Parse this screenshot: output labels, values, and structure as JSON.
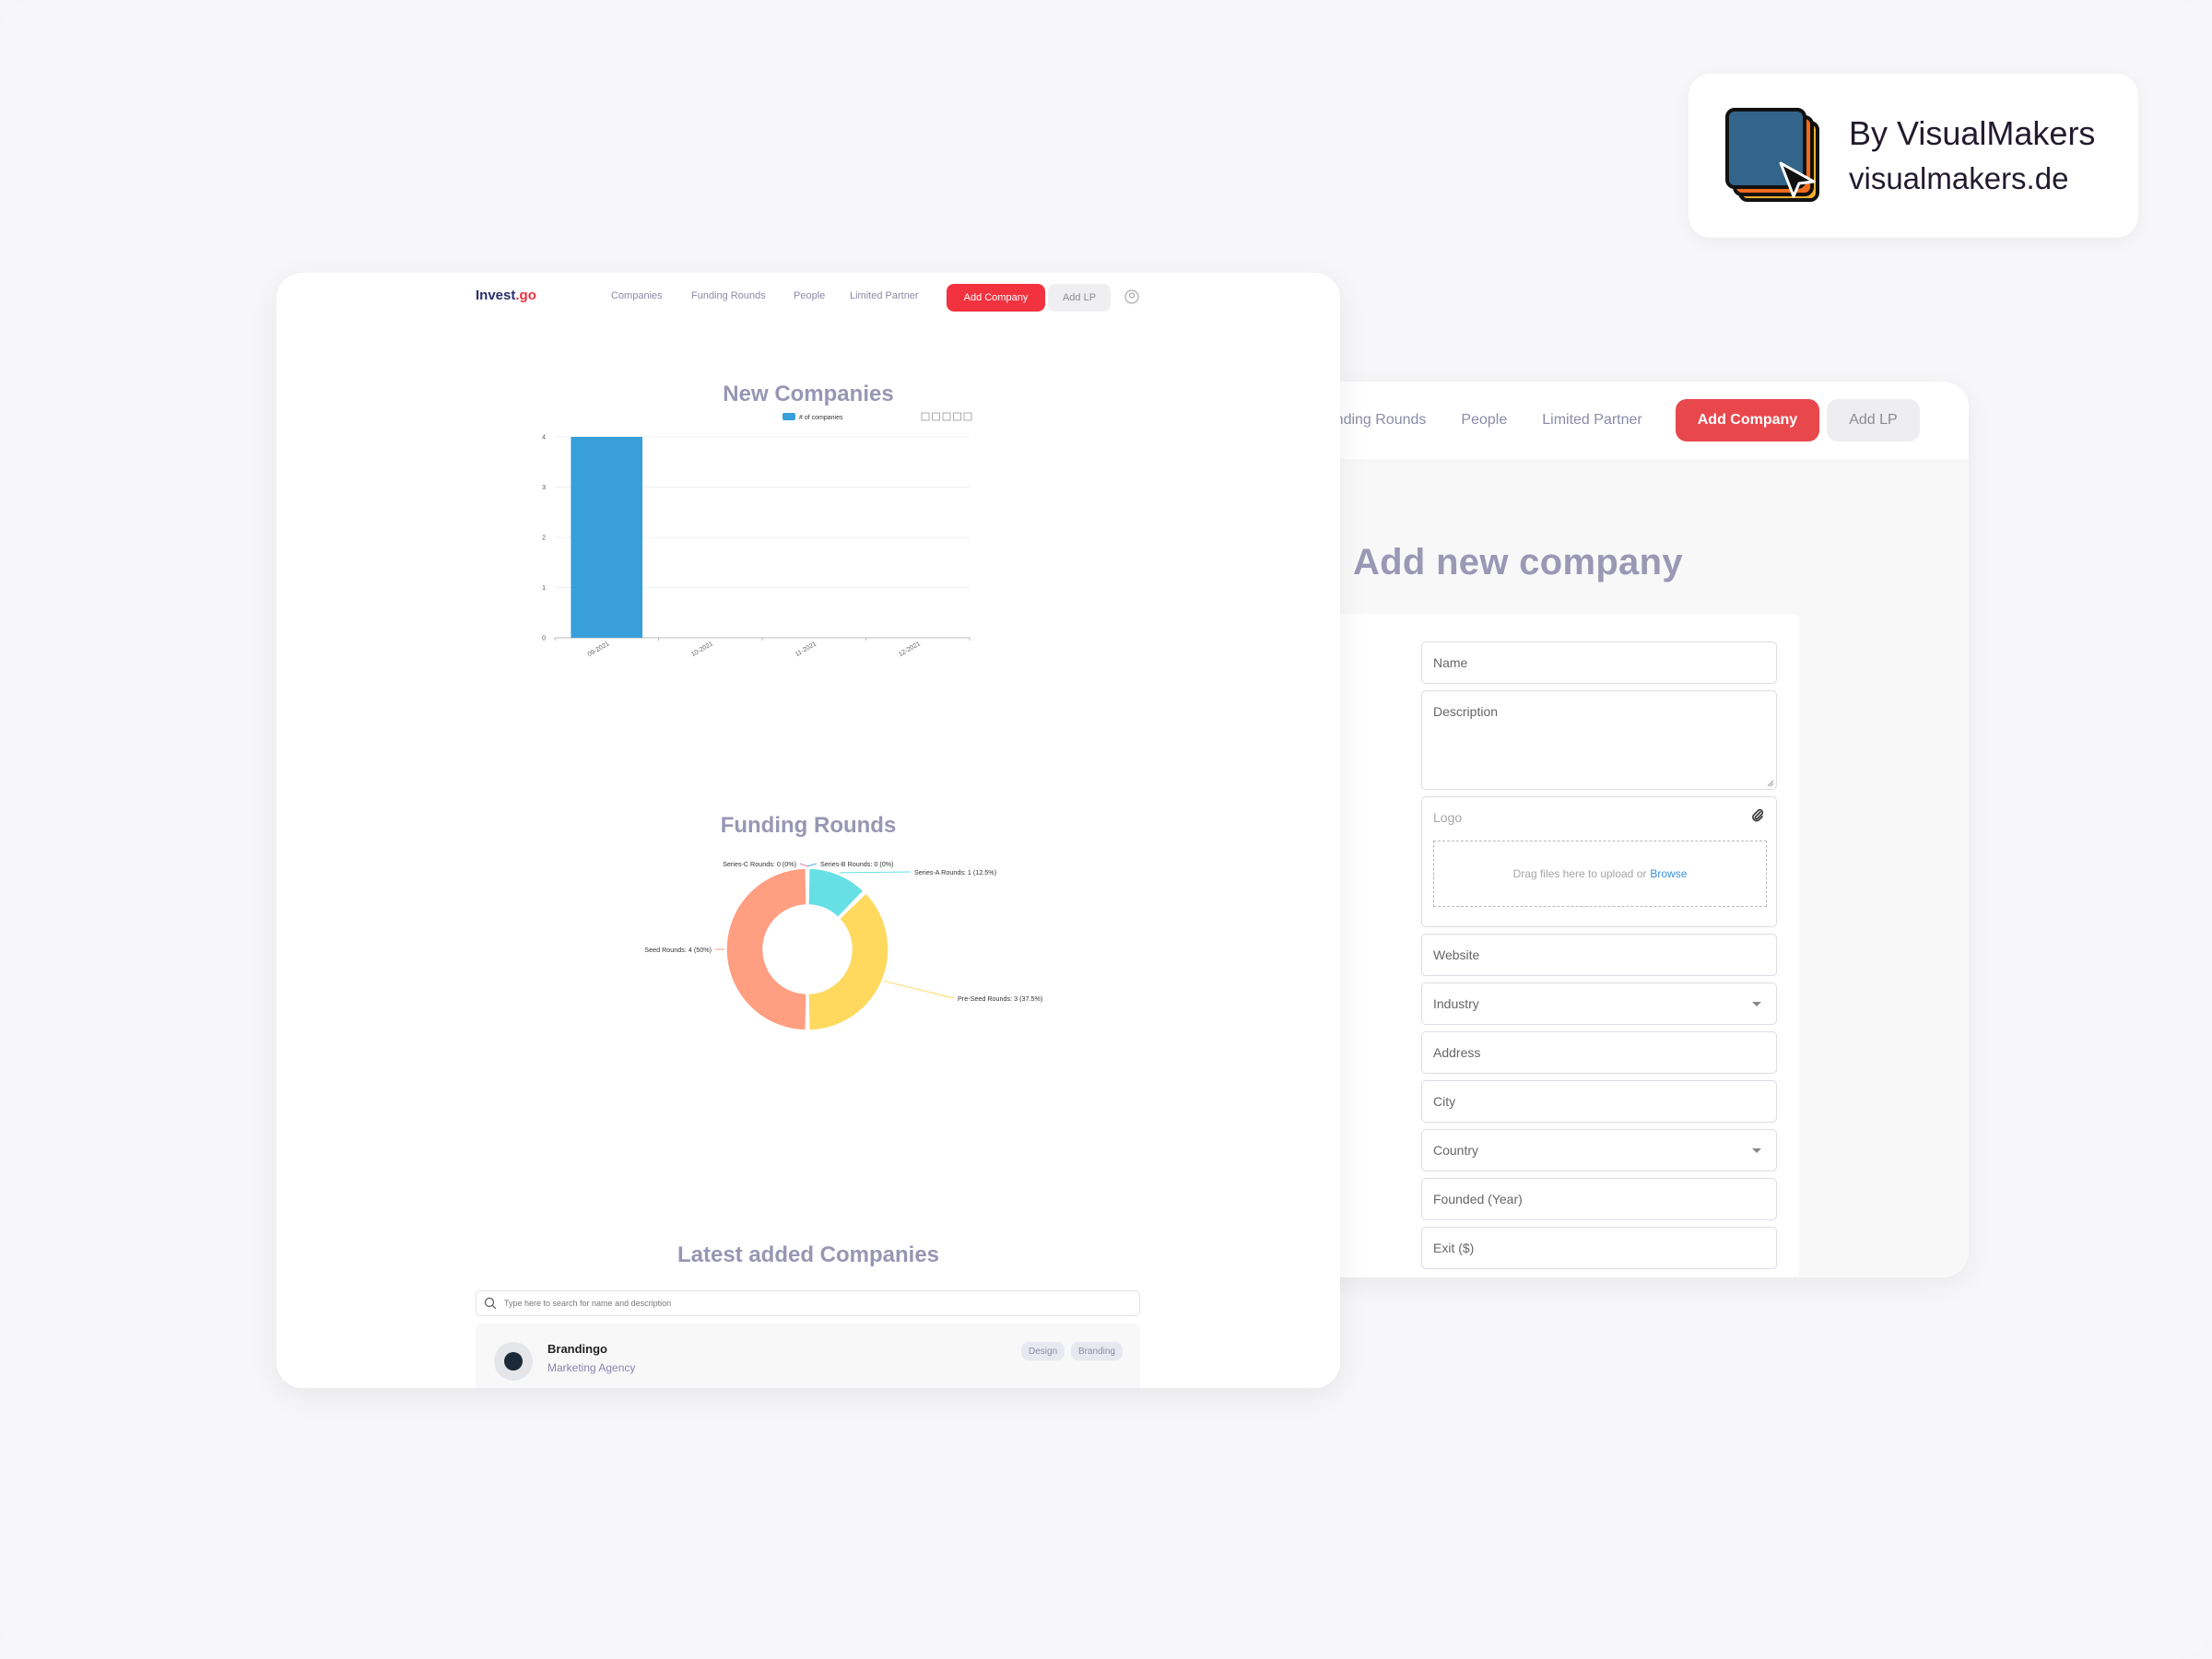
{
  "brand": {
    "title": "By VisualMakers",
    "url": "visualmakers.de",
    "colors": {
      "front": "#33658a",
      "mid": "#f26b1d",
      "back": "#f6ae2d"
    }
  },
  "front_window": {
    "nav": {
      "logo_main": "Invest",
      "logo_accent": ".go",
      "links": [
        "Companies",
        "Funding Rounds",
        "People",
        "Limited Partner"
      ],
      "add_company": "Add Company",
      "add_lp": "Add LP",
      "avatar_icon": "user-icon"
    },
    "sections": {
      "new_companies": "New Companies",
      "funding_rounds": "Funding Rounds",
      "latest": "Latest added Companies"
    },
    "toolbar_icons": [
      "download-icon",
      "zoom-icon",
      "zoom-reset-icon",
      "line-chart-icon",
      "bar-chart-icon"
    ],
    "pie_toolbar_icons": [
      "download-icon"
    ],
    "search": {
      "placeholder": "Type here to search for name and description"
    },
    "companies": [
      {
        "name": "Brandingo",
        "category": "Marketing Agency",
        "tags": [
          "Design",
          "Branding"
        ]
      }
    ]
  },
  "back_window": {
    "nav": {
      "links": [
        "Funding Rounds",
        "People",
        "Limited Partner"
      ],
      "add_company": "Add Company",
      "add_lp": "Add LP"
    },
    "title": "Add new company",
    "form": {
      "name": "Name",
      "description": "Description",
      "logo": "Logo",
      "dropzone_text": "Drag files here to upload or",
      "browse": "Browse",
      "website": "Website",
      "industry": "Industry",
      "address": "Address",
      "city": "City",
      "country": "Country",
      "founded": "Founded (Year)",
      "exit": "Exit ($)"
    }
  },
  "chart_data": [
    {
      "type": "bar",
      "title": "New Companies",
      "categories": [
        "09-2021",
        "10-2021",
        "11-2021",
        "12-2021"
      ],
      "series": [
        {
          "name": "# of companies",
          "values": [
            4,
            0,
            0,
            0
          ],
          "color": "#389fda"
        }
      ],
      "xlabel": "",
      "ylabel": "",
      "ylim": [
        0,
        4
      ],
      "yticks": [
        0,
        1,
        2,
        3,
        4
      ],
      "grid": true,
      "legend": "top-center"
    },
    {
      "type": "pie",
      "title": "Funding Rounds",
      "donut": true,
      "slices": [
        {
          "label": "Series-A Rounds",
          "value": 1,
          "percent": "12.5%",
          "color": "#66e0e5"
        },
        {
          "label": "Pre-Seed Rounds",
          "value": 3,
          "percent": "37.5%",
          "color": "#fed95e"
        },
        {
          "label": "Seed Rounds",
          "value": 4,
          "percent": "50%",
          "color": "#ff9e80"
        },
        {
          "label": "Series-C Rounds",
          "value": 0,
          "percent": "0%",
          "color": "#e879b8"
        },
        {
          "label": "Series-B Rounds",
          "value": 0,
          "percent": "0%",
          "color": "#4fb3e8"
        }
      ]
    }
  ]
}
